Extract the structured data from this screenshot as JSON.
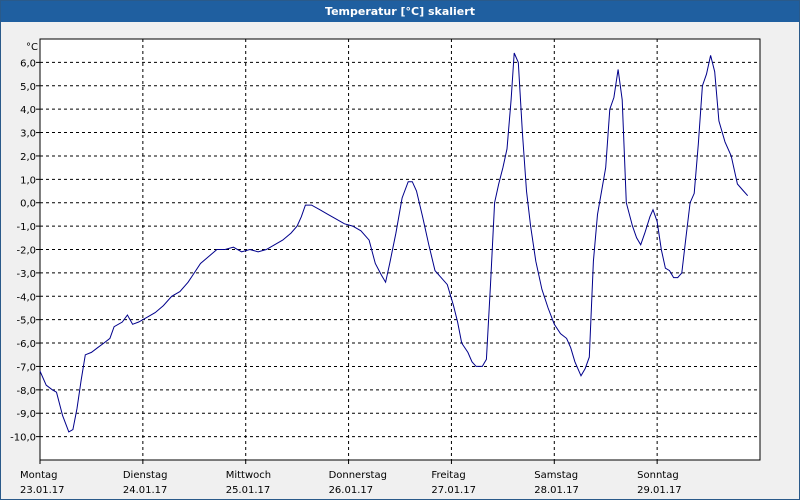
{
  "window": {
    "title": "Temperatur [°C] skaliert"
  },
  "chart_data": {
    "type": "line",
    "title": "Temperatur [°C] skaliert",
    "ylabel": "°C",
    "ylim": [
      -11,
      7
    ],
    "xlim": [
      0,
      7
    ],
    "grid": true,
    "y_ticks": [
      "6,0",
      "5,0",
      "4,0",
      "3,0",
      "2,0",
      "1,0",
      "0,0",
      "-1,0",
      "-2,0",
      "-3,0",
      "-4,0",
      "-5,0",
      "-6,0",
      "-7,0",
      "-8,0",
      "-9,0",
      "-10,0"
    ],
    "x_ticks": [
      {
        "day": "Montag",
        "date": "23.01.17"
      },
      {
        "day": "Dienstag",
        "date": "24.01.17"
      },
      {
        "day": "Mittwoch",
        "date": "25.01.17"
      },
      {
        "day": "Donnerstag",
        "date": "26.01.17"
      },
      {
        "day": "Freitag",
        "date": "27.01.17"
      },
      {
        "day": "Samstag",
        "date": "28.01.17"
      },
      {
        "day": "Sonntag",
        "date": "29.01.17"
      }
    ],
    "series": [
      {
        "color": "#00008b",
        "points": [
          [
            0.0,
            -7.2
          ],
          [
            0.06,
            -7.8
          ],
          [
            0.12,
            -8.0
          ],
          [
            0.16,
            -8.1
          ],
          [
            0.22,
            -9.1
          ],
          [
            0.28,
            -9.8
          ],
          [
            0.32,
            -9.7
          ],
          [
            0.36,
            -8.8
          ],
          [
            0.4,
            -7.6
          ],
          [
            0.44,
            -6.5
          ],
          [
            0.5,
            -6.4
          ],
          [
            0.56,
            -6.2
          ],
          [
            0.62,
            -6.0
          ],
          [
            0.68,
            -5.8
          ],
          [
            0.72,
            -5.3
          ],
          [
            0.8,
            -5.1
          ],
          [
            0.85,
            -4.8
          ],
          [
            0.9,
            -5.2
          ],
          [
            0.96,
            -5.1
          ],
          [
            1.04,
            -4.9
          ],
          [
            1.12,
            -4.7
          ],
          [
            1.2,
            -4.4
          ],
          [
            1.28,
            -4.0
          ],
          [
            1.36,
            -3.8
          ],
          [
            1.44,
            -3.4
          ],
          [
            1.5,
            -3.0
          ],
          [
            1.56,
            -2.6
          ],
          [
            1.64,
            -2.3
          ],
          [
            1.72,
            -2.0
          ],
          [
            1.8,
            -2.0
          ],
          [
            1.88,
            -1.9
          ],
          [
            1.96,
            -2.1
          ],
          [
            2.04,
            -2.0
          ],
          [
            2.12,
            -2.1
          ],
          [
            2.2,
            -2.0
          ],
          [
            2.28,
            -1.8
          ],
          [
            2.36,
            -1.6
          ],
          [
            2.44,
            -1.3
          ],
          [
            2.5,
            -1.0
          ],
          [
            2.54,
            -0.6
          ],
          [
            2.58,
            -0.1
          ],
          [
            2.64,
            -0.1
          ],
          [
            2.72,
            -0.3
          ],
          [
            2.8,
            -0.5
          ],
          [
            2.88,
            -0.7
          ],
          [
            2.96,
            -0.9
          ],
          [
            3.04,
            -1.0
          ],
          [
            3.12,
            -1.2
          ],
          [
            3.2,
            -1.6
          ],
          [
            3.26,
            -2.6
          ],
          [
            3.32,
            -3.1
          ],
          [
            3.36,
            -3.4
          ],
          [
            3.4,
            -2.6
          ],
          [
            3.46,
            -1.3
          ],
          [
            3.52,
            0.2
          ],
          [
            3.58,
            0.9
          ],
          [
            3.62,
            0.9
          ],
          [
            3.66,
            0.5
          ],
          [
            3.72,
            -0.6
          ],
          [
            3.78,
            -1.8
          ],
          [
            3.84,
            -2.9
          ],
          [
            3.9,
            -3.2
          ],
          [
            3.96,
            -3.5
          ],
          [
            4.02,
            -4.4
          ],
          [
            4.06,
            -5.1
          ],
          [
            4.1,
            -6.0
          ],
          [
            4.16,
            -6.4
          ],
          [
            4.2,
            -6.8
          ],
          [
            4.24,
            -7.0
          ],
          [
            4.3,
            -7.0
          ],
          [
            4.34,
            -6.7
          ],
          [
            4.38,
            -3.5
          ],
          [
            4.42,
            0.0
          ],
          [
            4.46,
            0.8
          ],
          [
            4.5,
            1.5
          ],
          [
            4.54,
            2.3
          ],
          [
            4.58,
            4.4
          ],
          [
            4.61,
            6.4
          ],
          [
            4.65,
            6.0
          ],
          [
            4.69,
            3.0
          ],
          [
            4.73,
            0.5
          ],
          [
            4.77,
            -1.0
          ],
          [
            4.82,
            -2.5
          ],
          [
            4.88,
            -3.7
          ],
          [
            4.94,
            -4.5
          ],
          [
            5.0,
            -5.2
          ],
          [
            5.06,
            -5.6
          ],
          [
            5.12,
            -5.8
          ],
          [
            5.16,
            -6.2
          ],
          [
            5.2,
            -6.8
          ],
          [
            5.26,
            -7.4
          ],
          [
            5.3,
            -7.1
          ],
          [
            5.34,
            -6.6
          ],
          [
            5.38,
            -2.5
          ],
          [
            5.42,
            -0.5
          ],
          [
            5.46,
            0.5
          ],
          [
            5.5,
            1.5
          ],
          [
            5.54,
            4.0
          ],
          [
            5.58,
            4.5
          ],
          [
            5.62,
            5.7
          ],
          [
            5.66,
            4.4
          ],
          [
            5.7,
            0.0
          ],
          [
            5.76,
            -1.0
          ],
          [
            5.8,
            -1.5
          ],
          [
            5.84,
            -1.8
          ],
          [
            5.88,
            -1.3
          ],
          [
            5.93,
            -0.6
          ],
          [
            5.96,
            -0.3
          ],
          [
            6.0,
            -0.8
          ],
          [
            6.04,
            -2.0
          ],
          [
            6.08,
            -2.8
          ],
          [
            6.12,
            -2.9
          ],
          [
            6.16,
            -3.2
          ],
          [
            6.2,
            -3.2
          ],
          [
            6.24,
            -3.0
          ],
          [
            6.28,
            -1.5
          ],
          [
            6.32,
            0.0
          ],
          [
            6.36,
            0.4
          ],
          [
            6.4,
            2.5
          ],
          [
            6.44,
            5.0
          ],
          [
            6.48,
            5.5
          ],
          [
            6.52,
            6.3
          ],
          [
            6.56,
            5.6
          ],
          [
            6.6,
            3.5
          ],
          [
            6.66,
            2.6
          ],
          [
            6.72,
            2.0
          ],
          [
            6.78,
            0.8
          ],
          [
            6.84,
            0.5
          ],
          [
            6.88,
            0.3
          ]
        ]
      }
    ]
  }
}
